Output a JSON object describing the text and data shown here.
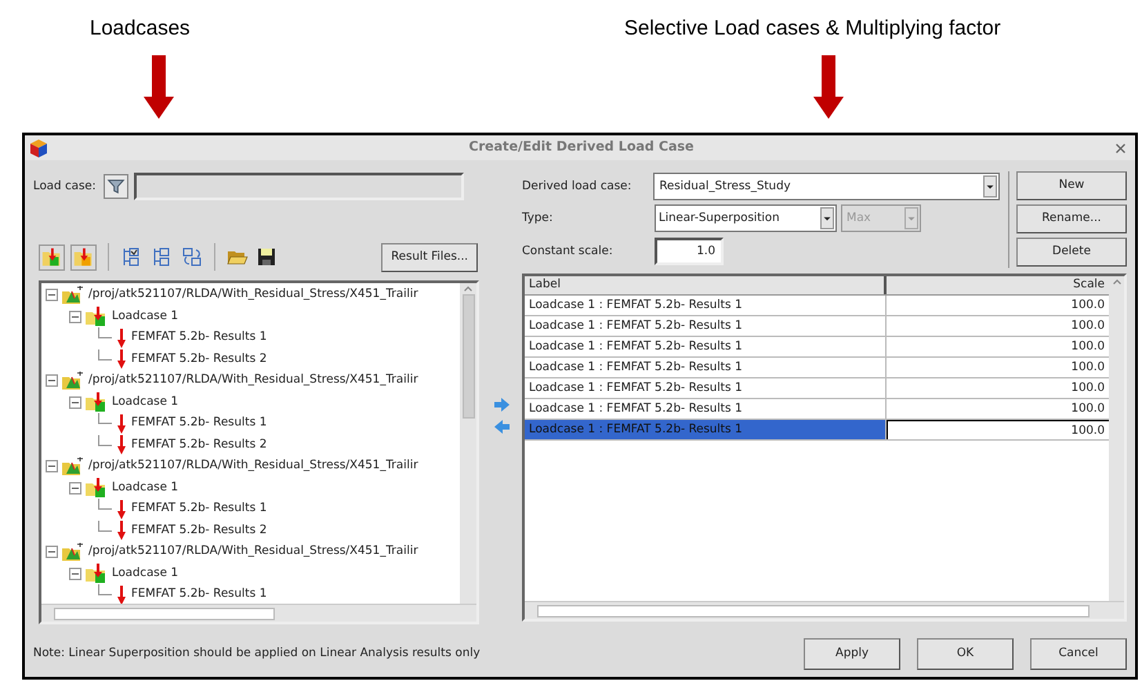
{
  "annotations": [
    {
      "text": "Loadcases"
    },
    {
      "text": "Selective Load cases & Multiplying factor"
    }
  ],
  "window": {
    "title": "Create/Edit Derived Load Case"
  },
  "filter": {
    "label": "Load case:"
  },
  "result_files_button": "Result Files...",
  "tree": [
    {
      "kind": "file",
      "label": "/proj/atk521107/RLDA/With_Residual_Stress/X451_Trailir",
      "expanded": true,
      "children": [
        {
          "kind": "loadcase",
          "label": "Loadcase 1",
          "expanded": true,
          "children": [
            {
              "kind": "result",
              "label": "FEMFAT 5.2b- Results 1"
            },
            {
              "kind": "result",
              "label": "FEMFAT 5.2b- Results 2"
            }
          ]
        }
      ]
    },
    {
      "kind": "file",
      "label": "/proj/atk521107/RLDA/With_Residual_Stress/X451_Trailir",
      "expanded": true,
      "children": [
        {
          "kind": "loadcase",
          "label": "Loadcase 1",
          "expanded": true,
          "children": [
            {
              "kind": "result",
              "label": "FEMFAT 5.2b- Results 1"
            },
            {
              "kind": "result",
              "label": "FEMFAT 5.2b- Results 2"
            }
          ]
        }
      ]
    },
    {
      "kind": "file",
      "label": "/proj/atk521107/RLDA/With_Residual_Stress/X451_Trailir",
      "expanded": true,
      "children": [
        {
          "kind": "loadcase",
          "label": "Loadcase 1",
          "expanded": true,
          "children": [
            {
              "kind": "result",
              "label": "FEMFAT 5.2b- Results 1"
            },
            {
              "kind": "result",
              "label": "FEMFAT 5.2b- Results 2"
            }
          ]
        }
      ]
    },
    {
      "kind": "file",
      "label": "/proj/atk521107/RLDA/With_Residual_Stress/X451_Trailir",
      "expanded": true,
      "children": [
        {
          "kind": "loadcase",
          "label": "Loadcase 1",
          "expanded": true,
          "children": [
            {
              "kind": "result",
              "label": "FEMFAT 5.2b- Results 1"
            }
          ]
        }
      ]
    }
  ],
  "form": {
    "derived_label": "Derived load case:",
    "derived_value": "Residual_Stress_Study",
    "type_label": "Type:",
    "type_value": "Linear-Superposition",
    "mode_value": "Max",
    "mode_disabled": true,
    "scale_label": "Constant scale:",
    "scale_value": "1.0"
  },
  "side_buttons": [
    "New",
    "Rename...",
    "Delete"
  ],
  "table": {
    "columns": [
      "Label",
      "Scale"
    ],
    "rows": [
      {
        "cells": [
          "Loadcase 1 : FEMFAT 5.2b- Results 1",
          "100.0"
        ],
        "selected": false
      },
      {
        "cells": [
          "Loadcase 1 : FEMFAT 5.2b- Results 1",
          "100.0"
        ],
        "selected": false
      },
      {
        "cells": [
          "Loadcase 1 : FEMFAT 5.2b- Results 1",
          "100.0"
        ],
        "selected": false
      },
      {
        "cells": [
          "Loadcase 1 : FEMFAT 5.2b- Results 1",
          "100.0"
        ],
        "selected": false
      },
      {
        "cells": [
          "Loadcase 1 : FEMFAT 5.2b- Results 1",
          "100.0"
        ],
        "selected": false
      },
      {
        "cells": [
          "Loadcase 1 : FEMFAT 5.2b- Results 1",
          "100.0"
        ],
        "selected": false
      },
      {
        "cells": [
          "Loadcase 1 : FEMFAT 5.2b- Results 1",
          "100.0"
        ],
        "selected": true
      }
    ]
  },
  "note": "Note: Linear Superposition should be applied on Linear Analysis results only",
  "buttons": [
    "Apply",
    "OK",
    "Cancel"
  ]
}
